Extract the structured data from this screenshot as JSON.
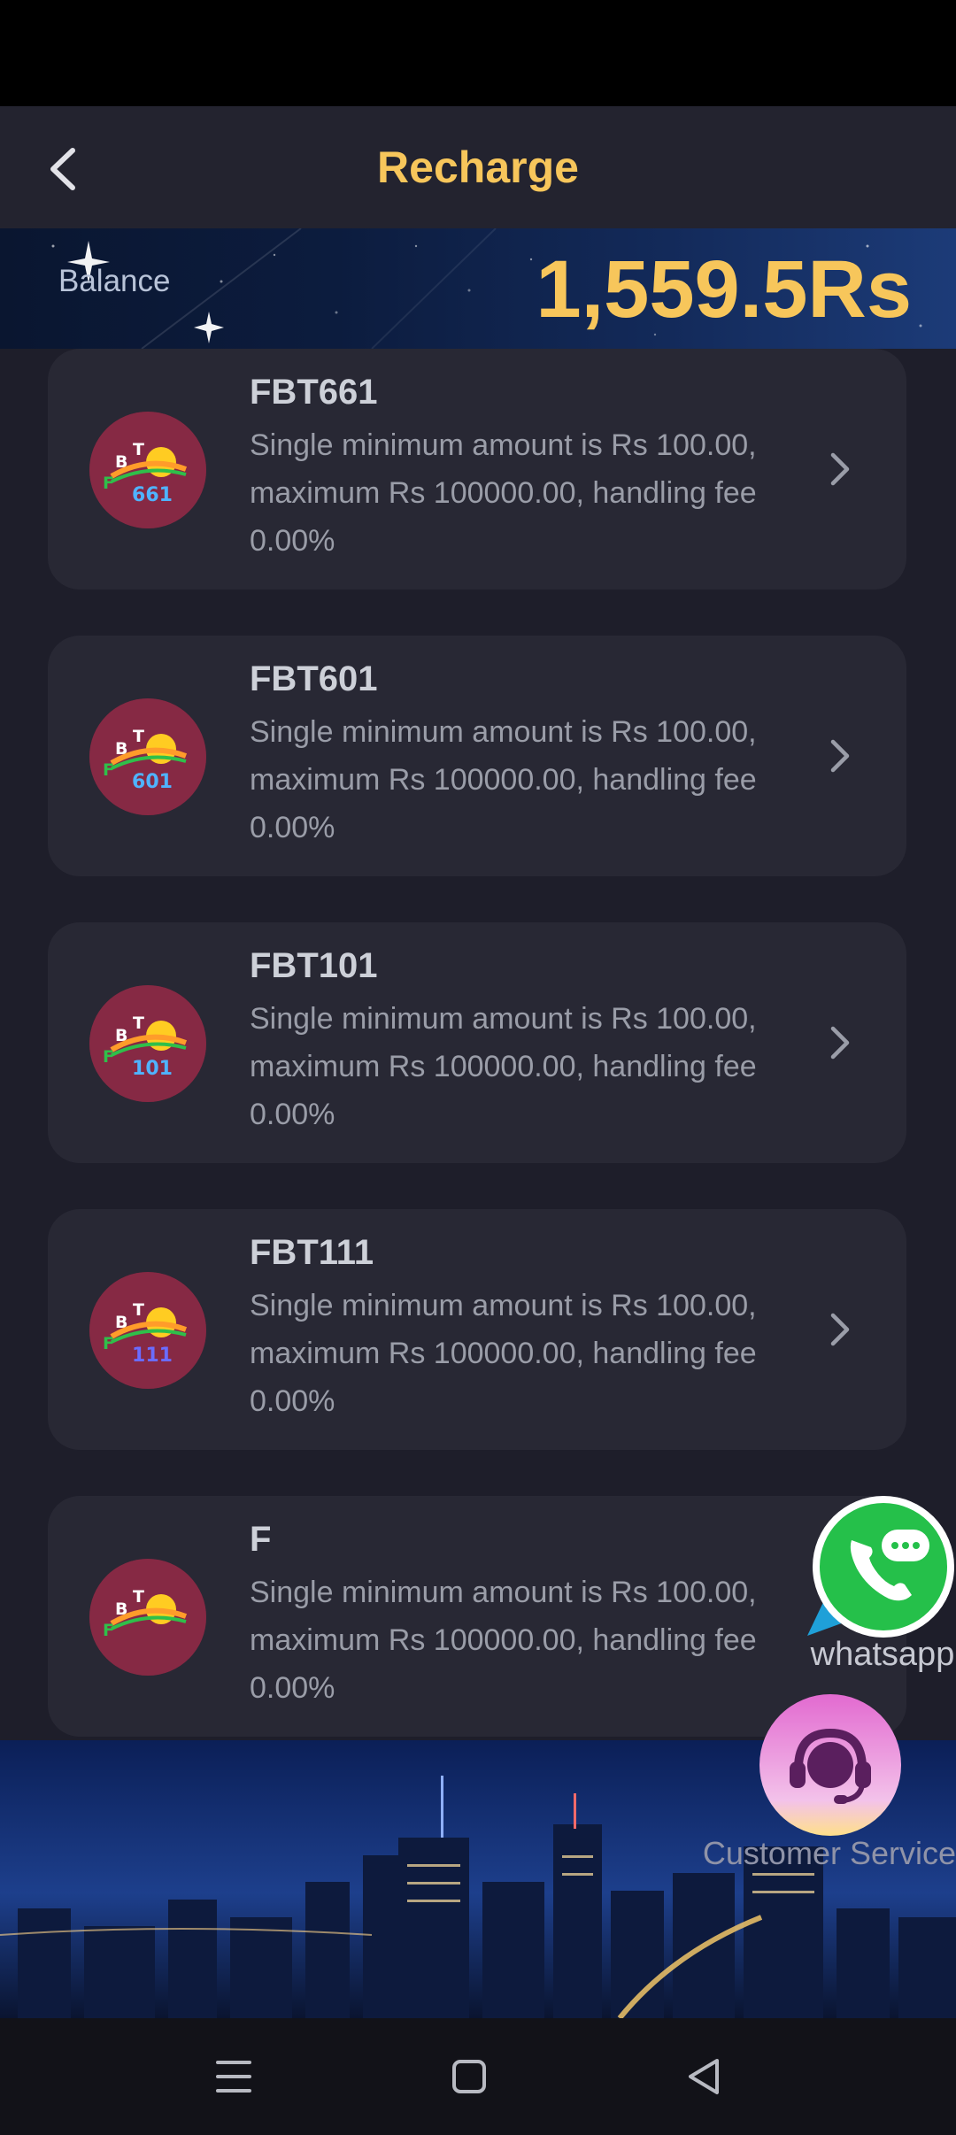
{
  "header": {
    "title": "Recharge"
  },
  "balance": {
    "label": "Balance",
    "value": "1,559.5Rs"
  },
  "channels": [
    {
      "name": "FBT661",
      "badge": "661",
      "badge_color": "#4fb3ff",
      "description": "Single minimum amount is Rs 100.00, maximum Rs 100000.00, handling fee 0.00%"
    },
    {
      "name": "FBT601",
      "badge": "601",
      "badge_color": "#4fb3ff",
      "description": "Single minimum amount is Rs 100.00, maximum Rs 100000.00, handling fee 0.00%"
    },
    {
      "name": "FBT101",
      "badge": "101",
      "badge_color": "#4fb3ff",
      "description": "Single minimum amount is Rs 100.00, maximum Rs 100000.00, handling fee 0.00%"
    },
    {
      "name": "FBT111",
      "badge": "111",
      "badge_color": "#6a6cff",
      "description": "Single minimum amount is Rs 100.00, maximum Rs 100000.00, handling fee 0.00%"
    },
    {
      "name": "F",
      "badge": "",
      "badge_color": "#4fb3ff",
      "description": "Single minimum amount is Rs 100.00, maximum Rs 100000.00, handling fee 0.00%"
    }
  ],
  "logo_letters": [
    "B",
    "T",
    "F"
  ],
  "floating": {
    "whatsapp_label": "whatsapp",
    "customer_service_label": "Customer Service"
  },
  "icons": {
    "back": "chevron-left-icon",
    "row_arrow": "chevron-right-icon",
    "whatsapp": "whatsapp-icon",
    "customer_service": "headset-icon",
    "nav_menu": "menu-icon",
    "nav_home": "square-icon",
    "nav_back": "triangle-back-icon"
  },
  "colors": {
    "accent": "#f7c65b",
    "card": "#282834",
    "background": "#1e1e2a",
    "whatsapp": "#25c04a"
  }
}
